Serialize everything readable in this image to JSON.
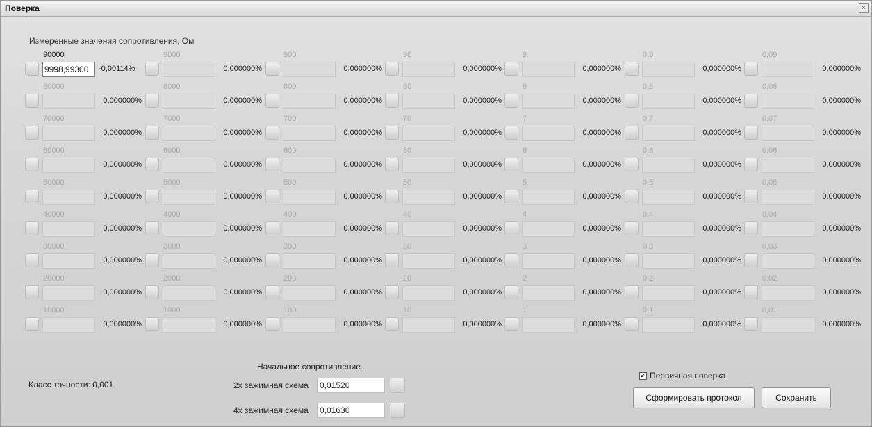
{
  "window": {
    "title": "Поверка",
    "close": "×"
  },
  "heading": "Измеренные значения сопротивления, Ом",
  "columns": [
    {
      "rows": [
        {
          "nominal": "90000",
          "value": "9998,99300",
          "deviation": "-0,00114%",
          "active": true
        },
        {
          "nominal": "80000",
          "value": "",
          "deviation": "0,000000%"
        },
        {
          "nominal": "70000",
          "value": "",
          "deviation": "0,000000%"
        },
        {
          "nominal": "60000",
          "value": "",
          "deviation": "0,000000%"
        },
        {
          "nominal": "50000",
          "value": "",
          "deviation": "0,000000%"
        },
        {
          "nominal": "40000",
          "value": "",
          "deviation": "0,000000%"
        },
        {
          "nominal": "30000",
          "value": "",
          "deviation": "0,000000%"
        },
        {
          "nominal": "20000",
          "value": "",
          "deviation": "0,000000%"
        },
        {
          "nominal": "10000",
          "value": "",
          "deviation": "0,000000%"
        }
      ]
    },
    {
      "rows": [
        {
          "nominal": "9000",
          "value": "",
          "deviation": "0,000000%"
        },
        {
          "nominal": "8000",
          "value": "",
          "deviation": "0,000000%"
        },
        {
          "nominal": "7000",
          "value": "",
          "deviation": "0,000000%"
        },
        {
          "nominal": "6000",
          "value": "",
          "deviation": "0,000000%"
        },
        {
          "nominal": "5000",
          "value": "",
          "deviation": "0,000000%"
        },
        {
          "nominal": "4000",
          "value": "",
          "deviation": "0,000000%"
        },
        {
          "nominal": "3000",
          "value": "",
          "deviation": "0,000000%"
        },
        {
          "nominal": "2000",
          "value": "",
          "deviation": "0,000000%"
        },
        {
          "nominal": "1000",
          "value": "",
          "deviation": "0,000000%"
        }
      ]
    },
    {
      "rows": [
        {
          "nominal": "900",
          "value": "",
          "deviation": "0,000000%"
        },
        {
          "nominal": "800",
          "value": "",
          "deviation": "0,000000%"
        },
        {
          "nominal": "700",
          "value": "",
          "deviation": "0,000000%"
        },
        {
          "nominal": "600",
          "value": "",
          "deviation": "0,000000%"
        },
        {
          "nominal": "500",
          "value": "",
          "deviation": "0,000000%"
        },
        {
          "nominal": "400",
          "value": "",
          "deviation": "0,000000%"
        },
        {
          "nominal": "300",
          "value": "",
          "deviation": "0,000000%"
        },
        {
          "nominal": "200",
          "value": "",
          "deviation": "0,000000%"
        },
        {
          "nominal": "100",
          "value": "",
          "deviation": "0,000000%"
        }
      ]
    },
    {
      "rows": [
        {
          "nominal": "90",
          "value": "",
          "deviation": "0,000000%"
        },
        {
          "nominal": "80",
          "value": "",
          "deviation": "0,000000%"
        },
        {
          "nominal": "70",
          "value": "",
          "deviation": "0,000000%"
        },
        {
          "nominal": "60",
          "value": "",
          "deviation": "0,000000%"
        },
        {
          "nominal": "50",
          "value": "",
          "deviation": "0,000000%"
        },
        {
          "nominal": "40",
          "value": "",
          "deviation": "0,000000%"
        },
        {
          "nominal": "30",
          "value": "",
          "deviation": "0,000000%"
        },
        {
          "nominal": "20",
          "value": "",
          "deviation": "0,000000%"
        },
        {
          "nominal": "10",
          "value": "",
          "deviation": "0,000000%"
        }
      ]
    },
    {
      "rows": [
        {
          "nominal": "9",
          "value": "",
          "deviation": "0,000000%"
        },
        {
          "nominal": "8",
          "value": "",
          "deviation": "0,000000%"
        },
        {
          "nominal": "7",
          "value": "",
          "deviation": "0,000000%"
        },
        {
          "nominal": "6",
          "value": "",
          "deviation": "0,000000%"
        },
        {
          "nominal": "5",
          "value": "",
          "deviation": "0,000000%"
        },
        {
          "nominal": "4",
          "value": "",
          "deviation": "0,000000%"
        },
        {
          "nominal": "3",
          "value": "",
          "deviation": "0,000000%"
        },
        {
          "nominal": "2",
          "value": "",
          "deviation": "0,000000%"
        },
        {
          "nominal": "1",
          "value": "",
          "deviation": "0,000000%"
        }
      ]
    },
    {
      "rows": [
        {
          "nominal": "0,9",
          "value": "",
          "deviation": "0,000000%"
        },
        {
          "nominal": "0,8",
          "value": "",
          "deviation": "0,000000%"
        },
        {
          "nominal": "0,7",
          "value": "",
          "deviation": "0,000000%"
        },
        {
          "nominal": "0,6",
          "value": "",
          "deviation": "0,000000%"
        },
        {
          "nominal": "0,5",
          "value": "",
          "deviation": "0,000000%"
        },
        {
          "nominal": "0,4",
          "value": "",
          "deviation": "0,000000%"
        },
        {
          "nominal": "0,3",
          "value": "",
          "deviation": "0,000000%"
        },
        {
          "nominal": "0,2",
          "value": "",
          "deviation": "0,000000%"
        },
        {
          "nominal": "0,1",
          "value": "",
          "deviation": "0,000000%"
        }
      ]
    },
    {
      "rows": [
        {
          "nominal": "0,09",
          "value": "",
          "deviation": "0,000000%"
        },
        {
          "nominal": "0,08",
          "value": "",
          "deviation": "0,000000%"
        },
        {
          "nominal": "0,07",
          "value": "",
          "deviation": "0,000000%"
        },
        {
          "nominal": "0,06",
          "value": "",
          "deviation": "0,000000%"
        },
        {
          "nominal": "0,05",
          "value": "",
          "deviation": "0,000000%"
        },
        {
          "nominal": "0,04",
          "value": "",
          "deviation": "0,000000%"
        },
        {
          "nominal": "0,03",
          "value": "",
          "deviation": "0,000000%"
        },
        {
          "nominal": "0,02",
          "value": "",
          "deviation": "0,000000%"
        },
        {
          "nominal": "0,01",
          "value": "",
          "deviation": "0,000000%"
        }
      ]
    }
  ],
  "accuracy_class": "Класс точности: 0,001",
  "initial_resistance": {
    "heading": "Начальное сопротивление.",
    "two_wire_label": "2х зажимная схема",
    "two_wire_value": "0,01520",
    "four_wire_label": "4х зажимная схема",
    "four_wire_value": "0,01630"
  },
  "primary_check": {
    "label": "Первичная поверка",
    "checked": true,
    "mark": "✔"
  },
  "buttons": {
    "generate_protocol": "Сформировать протокол",
    "save": "Сохранить"
  }
}
